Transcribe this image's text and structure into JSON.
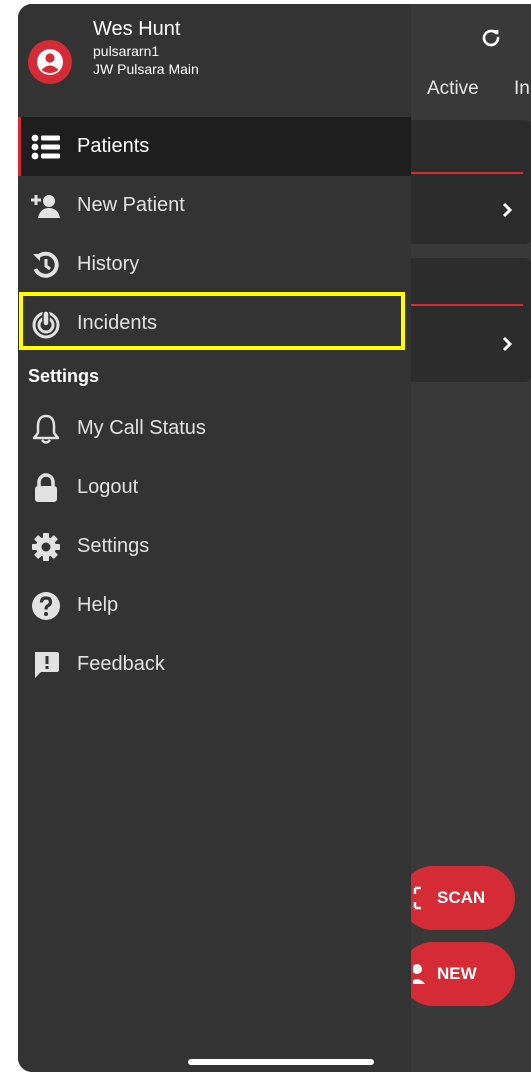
{
  "user": {
    "name": "Wes Hunt",
    "username": "pulsararn1",
    "organization": "JW Pulsara Main"
  },
  "menu": [
    {
      "label": "Patients",
      "icon": "list-icon",
      "active": true
    },
    {
      "label": "New Patient",
      "icon": "add-user-icon"
    },
    {
      "label": "History",
      "icon": "history-icon"
    },
    {
      "label": "Incidents",
      "icon": "incident-icon",
      "highlighted": true
    }
  ],
  "settings_section": {
    "title": "Settings",
    "items": [
      {
        "label": "My Call Status",
        "icon": "bell-icon"
      },
      {
        "label": "Logout",
        "icon": "lock-icon"
      },
      {
        "label": "Settings",
        "icon": "gear-icon"
      },
      {
        "label": "Help",
        "icon": "help-icon"
      },
      {
        "label": "Feedback",
        "icon": "feedback-icon"
      }
    ]
  },
  "background": {
    "tabs": [
      "Active",
      "In"
    ],
    "scan_label": "SCAN",
    "new_label": "NEW",
    "refresh_icon": "refresh-icon"
  },
  "colors": {
    "accent": "#d42b36",
    "drawer_bg": "#333333",
    "highlight": "#ffff00"
  }
}
